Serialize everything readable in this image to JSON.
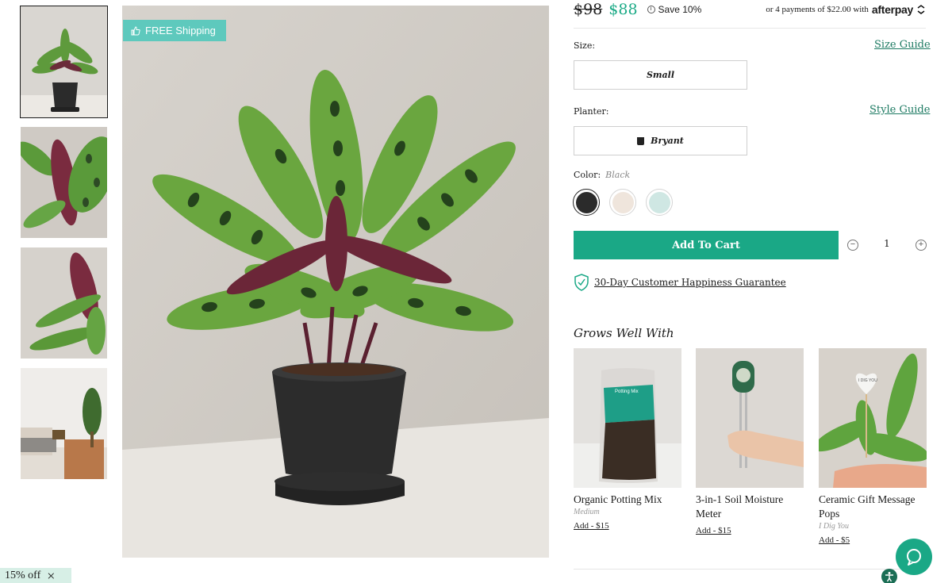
{
  "badge": {
    "free_shipping": "FREE Shipping",
    "icon": "thumbs-up-icon"
  },
  "pricing": {
    "old_price": "$98",
    "new_price": "$88",
    "save": "Save 10%",
    "installments": "or 4 payments of $22.00 with",
    "afterpay": "afterpay"
  },
  "size": {
    "label": "Size:",
    "guide_link": "Size Guide",
    "value": "Small"
  },
  "planter": {
    "label": "Planter:",
    "guide_link": "Style Guide",
    "value": "Bryant"
  },
  "color": {
    "label": "Color:",
    "value": "Black",
    "swatches": [
      "#2b2b2b",
      "#efe5dc",
      "#cfe7e3"
    ]
  },
  "cart": {
    "button": "Add To Cart",
    "quantity": "1",
    "minus": "−",
    "plus": "+"
  },
  "guarantee": {
    "text": "30-Day Customer Happiness Guarantee"
  },
  "grows_well_with": {
    "title": "Grows Well With",
    "items": [
      {
        "name": "Organic Potting Mix",
        "variant": "Medium",
        "add": "Add - $15"
      },
      {
        "name": "3-in-1 Soil Moisture Meter",
        "variant": "",
        "add": "Add - $15"
      },
      {
        "name": "Ceramic Gift Message Pops",
        "variant": "I Dig You",
        "add": "Add - $5"
      }
    ]
  },
  "promo": {
    "text": "15% off",
    "close": "×"
  },
  "colors": {
    "accent": "#1aa886",
    "link": "#1d7a62",
    "badge": "#5ec9bd"
  },
  "gift_pop_text": "I DIG YOU",
  "potting_mix_label": "Potting Mix"
}
